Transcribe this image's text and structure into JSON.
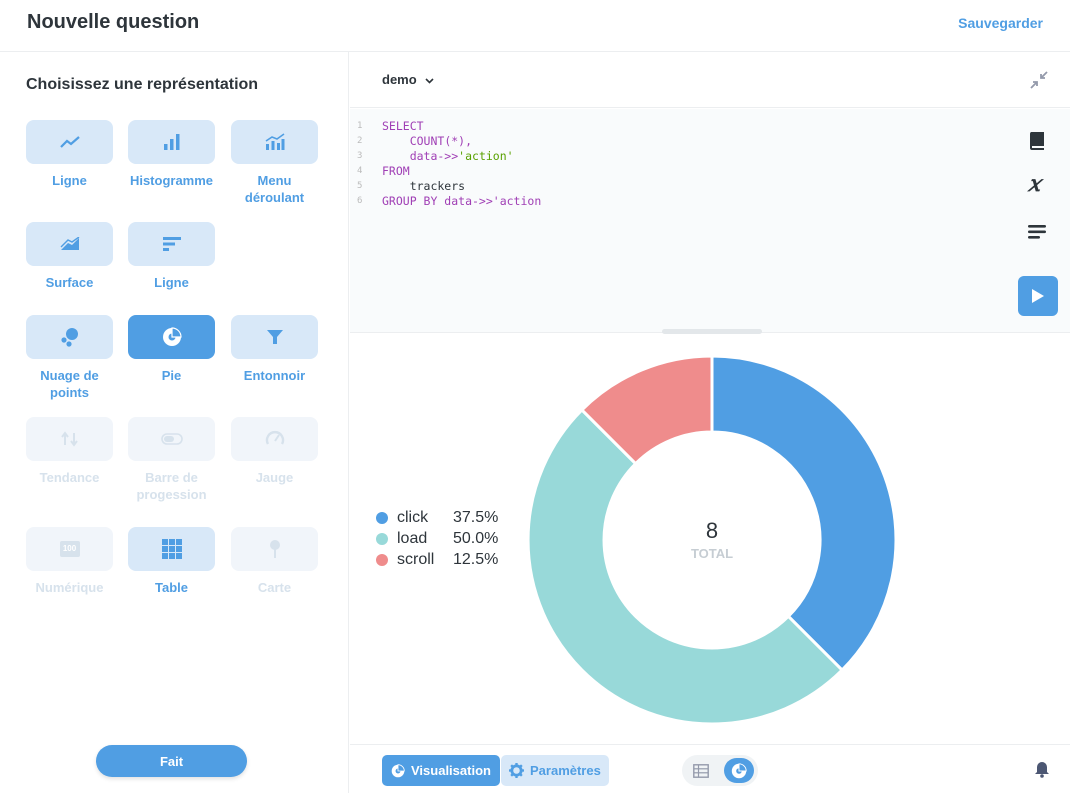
{
  "header": {
    "title": "Nouvelle question",
    "save_label": "Sauvegarder"
  },
  "sidebar": {
    "title": "Choisissez une représentation",
    "items": [
      {
        "label": "Ligne",
        "icon": "line-chart-icon",
        "state": "normal"
      },
      {
        "label": "Histogramme",
        "icon": "bar-chart-icon",
        "state": "normal"
      },
      {
        "label": "Menu déroulant",
        "icon": "combo-chart-icon",
        "state": "normal"
      },
      {
        "label": "Surface",
        "icon": "area-chart-icon",
        "state": "normal"
      },
      {
        "label": "Ligne",
        "icon": "row-chart-icon",
        "state": "normal"
      },
      {
        "label": "Nuage de points",
        "icon": "scatter-icon",
        "state": "normal"
      },
      {
        "label": "Pie",
        "icon": "pie-icon",
        "state": "active"
      },
      {
        "label": "Entonnoir",
        "icon": "funnel-icon",
        "state": "normal"
      },
      {
        "label": "Tendance",
        "icon": "trend-icon",
        "state": "disabled"
      },
      {
        "label": "Barre de progession",
        "icon": "progress-icon",
        "state": "disabled"
      },
      {
        "label": "Jauge",
        "icon": "gauge-icon",
        "state": "disabled"
      },
      {
        "label": "Numérique",
        "icon": "number-icon",
        "state": "disabled"
      },
      {
        "label": "Table",
        "icon": "table-icon",
        "state": "normal"
      },
      {
        "label": "Carte",
        "icon": "map-pin-icon",
        "state": "disabled"
      }
    ],
    "number_icon_text": "100",
    "done_label": "Fait"
  },
  "editor": {
    "database": "demo",
    "lines": [
      {
        "n": "1",
        "parts": [
          {
            "t": "SELECT",
            "c": "kw"
          }
        ]
      },
      {
        "n": "2",
        "parts": [
          {
            "t": "    COUNT",
            "c": "fn"
          },
          {
            "t": "(*),",
            "c": "fn"
          }
        ]
      },
      {
        "n": "3",
        "parts": [
          {
            "t": "    data->>",
            "c": "kw"
          },
          {
            "t": "'action'",
            "c": "str"
          }
        ]
      },
      {
        "n": "4",
        "parts": [
          {
            "t": "FROM",
            "c": "kw"
          }
        ]
      },
      {
        "n": "5",
        "parts": [
          {
            "t": "    trackers",
            "c": "txt"
          }
        ]
      },
      {
        "n": "6",
        "parts": [
          {
            "t": "GROUP BY data->>",
            "c": "kw"
          },
          {
            "t": "'action",
            "c": "kw"
          }
        ]
      }
    ]
  },
  "chart_data": {
    "type": "pie",
    "categories": [
      "click",
      "load",
      "scroll"
    ],
    "values": [
      37.5,
      50.0,
      12.5
    ],
    "labels": [
      "37.5%",
      "50.0%",
      "12.5%"
    ],
    "colors": [
      "#509ee3",
      "#98d9d9",
      "#ef8c8c"
    ],
    "total": "8",
    "total_label": "TOTAL"
  },
  "footer": {
    "visualization_label": "Visualisation",
    "params_label": "Paramètres"
  }
}
